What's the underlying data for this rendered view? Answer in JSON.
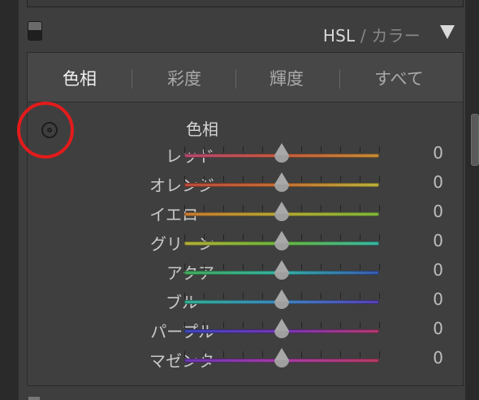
{
  "panel": {
    "title_hsl": "HSL",
    "title_sep": " / ",
    "title_color": "カラー",
    "toggle_icon": "panel-toggle-icon",
    "collapse_icon": "triangle-down-icon"
  },
  "tabs": [
    {
      "label": "色相"
    },
    {
      "label": "彩度"
    },
    {
      "label": "輝度"
    },
    {
      "label": "すべて"
    }
  ],
  "content": {
    "target_icon": "target-adjust-icon",
    "section_title": "色相"
  },
  "sliders": [
    {
      "label": "レッド",
      "value": "0",
      "colors": [
        "#b04a70",
        "#c25b3e",
        "#c58c35"
      ]
    },
    {
      "label": "オレンジ",
      "value": "0",
      "colors": [
        "#b84a3a",
        "#c46f35",
        "#b9b23a"
      ]
    },
    {
      "label": "イエロー",
      "value": "0",
      "colors": [
        "#c47a33",
        "#b3a536",
        "#7eb43b"
      ]
    },
    {
      "label": "グリーン",
      "value": "0",
      "colors": [
        "#b2ad38",
        "#6ab53d",
        "#38b5a4"
      ]
    },
    {
      "label": "アクア",
      "value": "0",
      "colors": [
        "#41a95b",
        "#36aea2",
        "#375ab1"
      ]
    },
    {
      "label": "ブルー",
      "value": "0",
      "colors": [
        "#34ac92",
        "#3f84bb",
        "#5840b1"
      ]
    },
    {
      "label": "パープル",
      "value": "0",
      "colors": [
        "#3e46b6",
        "#7436b3",
        "#b03b6e"
      ]
    },
    {
      "label": "マゼンタ",
      "value": "0",
      "colors": [
        "#6a37b0",
        "#a33ca2",
        "#b23c62"
      ]
    }
  ]
}
